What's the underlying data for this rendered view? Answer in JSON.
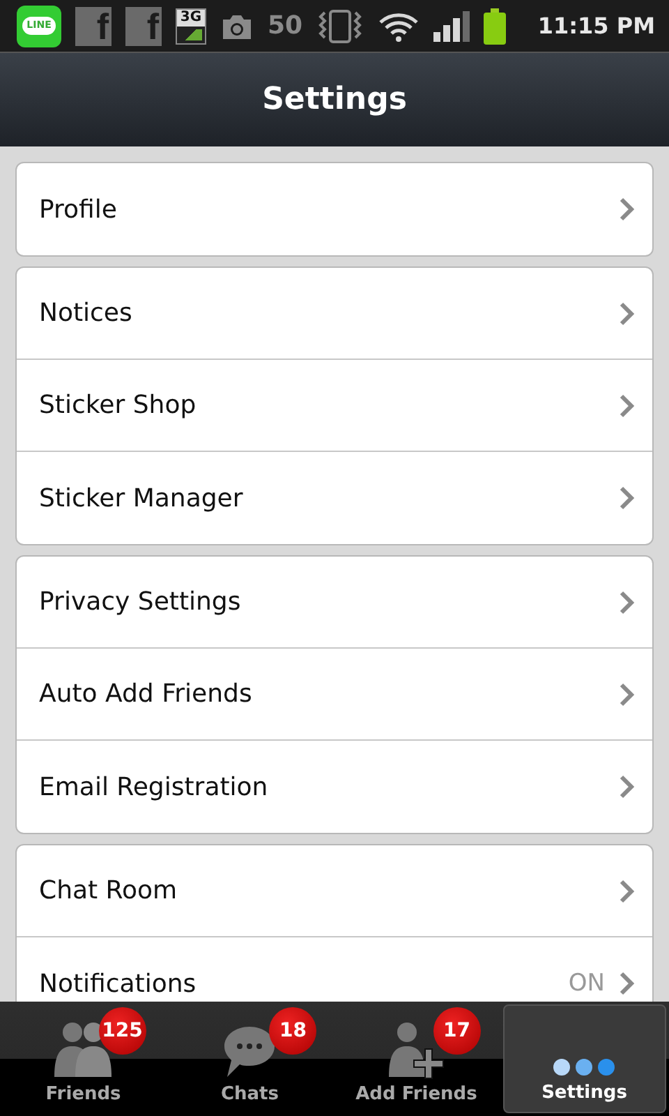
{
  "status_bar": {
    "icons": [
      {
        "kind": "line",
        "text": "LINE"
      },
      {
        "kind": "facebook",
        "text": "f"
      },
      {
        "kind": "facebook",
        "text": "f"
      },
      {
        "kind": "mobiledata",
        "text": "3G"
      },
      {
        "kind": "camera"
      },
      {
        "kind": "text",
        "text": "50"
      },
      {
        "kind": "vibrate"
      },
      {
        "kind": "wifi"
      },
      {
        "kind": "signal"
      },
      {
        "kind": "battery"
      }
    ],
    "time": "11:15 PM"
  },
  "title_bar": {
    "title": "Settings"
  },
  "groups": [
    {
      "items": [
        {
          "label": "Profile"
        }
      ]
    },
    {
      "items": [
        {
          "label": "Notices"
        },
        {
          "label": "Sticker Shop"
        },
        {
          "label": "Sticker Manager"
        }
      ]
    },
    {
      "items": [
        {
          "label": "Privacy Settings"
        },
        {
          "label": "Auto Add Friends"
        },
        {
          "label": "Email Registration"
        }
      ]
    },
    {
      "items": [
        {
          "label": "Chat Room"
        },
        {
          "label": "Notifications",
          "value": "ON"
        }
      ]
    }
  ],
  "tabs": [
    {
      "kind": "friends",
      "label": "Friends",
      "badge": "125",
      "selected": false
    },
    {
      "kind": "chats",
      "label": "Chats",
      "badge": "18",
      "selected": false
    },
    {
      "kind": "add-friends",
      "label": "Add Friends",
      "badge": "17",
      "selected": false
    },
    {
      "kind": "settings",
      "label": "Settings",
      "selected": true
    }
  ]
}
